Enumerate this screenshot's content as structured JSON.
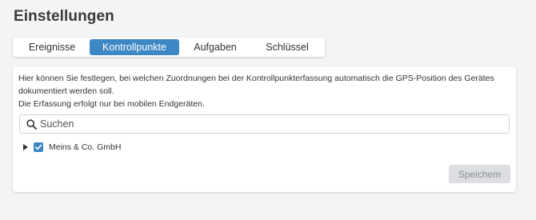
{
  "page": {
    "title": "Einstellungen"
  },
  "tabs": [
    {
      "label": "Ereignisse",
      "active": false
    },
    {
      "label": "Kontrollpunkte",
      "active": true
    },
    {
      "label": "Aufgaben",
      "active": false
    },
    {
      "label": "Schlüssel",
      "active": false
    }
  ],
  "card": {
    "description_line1": "Hier können Sie festlegen, bei welchen Zuordnungen bei der Kontrollpunkterfassung automatisch die GPS-Position des Gerätes",
    "description_line2": "dokumentiert werden soll.",
    "description_line3": "Die Erfassung erfolgt nur bei mobilen Endgeräten.",
    "search": {
      "placeholder": "Suchen",
      "value": "",
      "icon": "search-icon"
    },
    "tree": [
      {
        "label": "Meins & Co. GmbH",
        "checked": true,
        "expanded": false
      }
    ],
    "save_label": "Speichem",
    "save_disabled": true
  },
  "colors": {
    "accent": "#3d87c4",
    "background": "#f3f4f6",
    "disabled_button_bg": "#dcdee1",
    "disabled_button_text": "#8a8d91"
  }
}
